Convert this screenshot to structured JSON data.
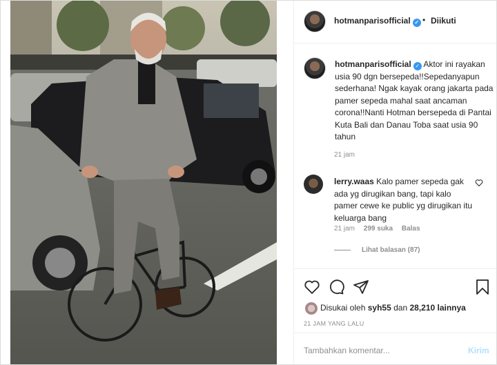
{
  "post": {
    "username": "hotmanparisofficial",
    "separator": "•",
    "follow_status": "Diikuti"
  },
  "caption": {
    "username": "hotmanparisofficial",
    "text": "Aktor ini rayakan usia 90 dgn bersepeda!!Sepedanyapun sederhana! Ngak kayak orang jakarta pada pamer sepeda mahal saat ancaman corona!!Nanti Hotman bersepeda di Pantai Kuta Bali dan Danau Toba saat usia 90 tahun",
    "time": "21 jam"
  },
  "comment": {
    "username": "lerry.waas",
    "text": "Kalo pamer sepeda gak ada yg dirugikan bang, tapi kalo pamer cewe ke public yg dirugikan itu keluarga bang",
    "time": "21 jam",
    "likes": "299 suka",
    "reply": "Balas",
    "view_replies": "Lihat balasan (87)"
  },
  "likes": {
    "prefix": "Disukai oleh",
    "user": "syh55",
    "middle": "dan",
    "count": "28,210 lainnya"
  },
  "posted_ago": "21 JAM YANG LALU",
  "add_comment": {
    "placeholder": "Tambahkan komentar...",
    "post_label": "Kirim"
  },
  "colors": {
    "verified": "#3897f0",
    "muted": "#8e8e8e",
    "post_disabled": "#b2dffc"
  },
  "icons": [
    "verified-icon",
    "heart-icon",
    "comment-icon",
    "share-icon",
    "bookmark-icon",
    "small-heart-icon"
  ]
}
